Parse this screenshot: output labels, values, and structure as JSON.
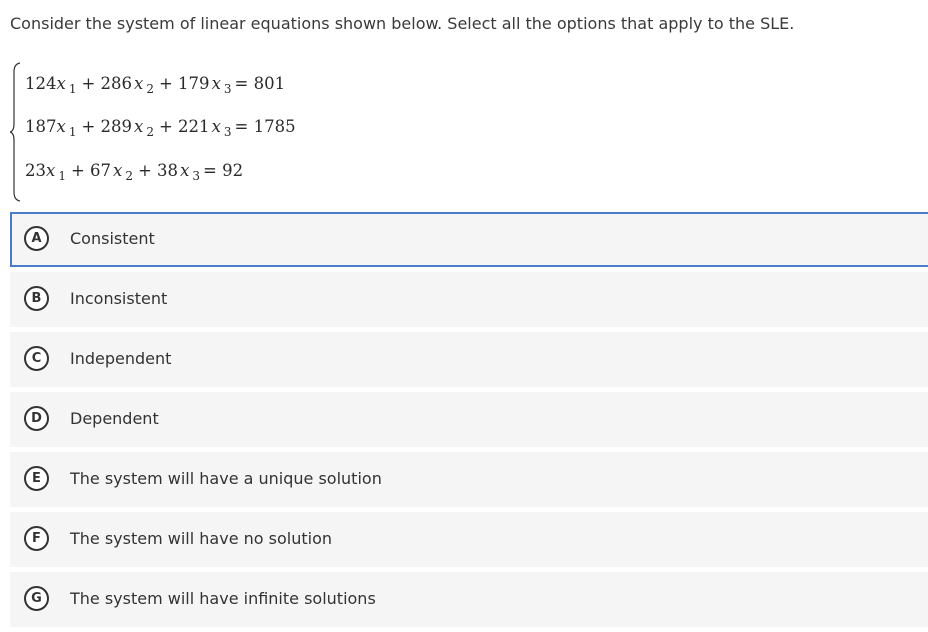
{
  "question": {
    "text": "Consider the system of linear equations shown below. Select all the options that apply to the SLE."
  },
  "system": {
    "equations": [
      {
        "c1": "124",
        "c2": "+ 286",
        "c3": "+ 179",
        "rhs": "= 801"
      },
      {
        "c1": "187",
        "c2": "+ 289",
        "c3": "+ 221",
        "rhs": "= 1785"
      },
      {
        "c1": "23",
        "c2": "+ 67",
        "c3": "+ 38",
        "rhs": "= 92"
      }
    ],
    "variable": "x",
    "subscripts": [
      "1",
      "2",
      "3"
    ]
  },
  "options": [
    {
      "letter": "A",
      "label": "Consistent",
      "selected": true
    },
    {
      "letter": "B",
      "label": "Inconsistent",
      "selected": false
    },
    {
      "letter": "C",
      "label": "Independent",
      "selected": false
    },
    {
      "letter": "D",
      "label": "Dependent",
      "selected": false
    },
    {
      "letter": "E",
      "label": "The system will have a unique solution",
      "selected": false
    },
    {
      "letter": "F",
      "label": "The system will have no solution",
      "selected": false
    },
    {
      "letter": "G",
      "label": "The system will have infinite solutions",
      "selected": false
    }
  ],
  "colors": {
    "selected_border": "#4a7cc9",
    "option_background": "#f5f5f5",
    "text": "#333333"
  }
}
